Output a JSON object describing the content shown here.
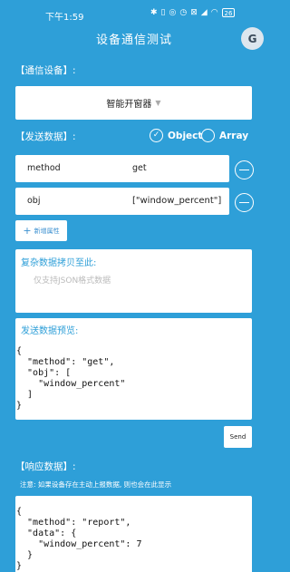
{
  "status_bar": {
    "time": "下午1:59",
    "icons": [
      "bluetooth-icon",
      "vibrate-icon",
      "nfc-icon",
      "alarm-icon",
      "no-sim-icon",
      "signal-icon",
      "wifi-icon",
      "battery-icon"
    ],
    "battery_level": "26"
  },
  "header": {
    "title": "设备通信测试",
    "menu_icon_glyph": "G"
  },
  "device_section": {
    "label": "【通信设备】:",
    "selected_device": "智能开窗器"
  },
  "send_section": {
    "label": "【发送数据】:",
    "radio_options": [
      {
        "label": "Object",
        "checked": true
      },
      {
        "label": "Array",
        "checked": false
      }
    ],
    "fields": [
      {
        "key": "method",
        "value": "get"
      },
      {
        "key": "obj",
        "value": "[\"window_percent\"]"
      }
    ],
    "add_button_label": "新增属性"
  },
  "paste_section": {
    "label": "复杂数据拷贝至此:",
    "placeholder": "仅支持JSON格式数据"
  },
  "preview_section": {
    "label": "发送数据预览:",
    "content": "{\n  \"method\": \"get\",\n  \"obj\": [\n    \"window_percent\"\n  ]\n}"
  },
  "send_button_label": "Send",
  "response_section": {
    "label": "【响应数据】:",
    "note": "注意: 如果设备存在主动上报数据, 则也会在此显示",
    "content": "{\n  \"method\": \"report\",\n  \"data\": {\n    \"window_percent\": 7\n  }\n}"
  },
  "colors": {
    "background": "#2e9fd8",
    "panel": "#ffffff",
    "accent_text": "#2e9fd8"
  }
}
